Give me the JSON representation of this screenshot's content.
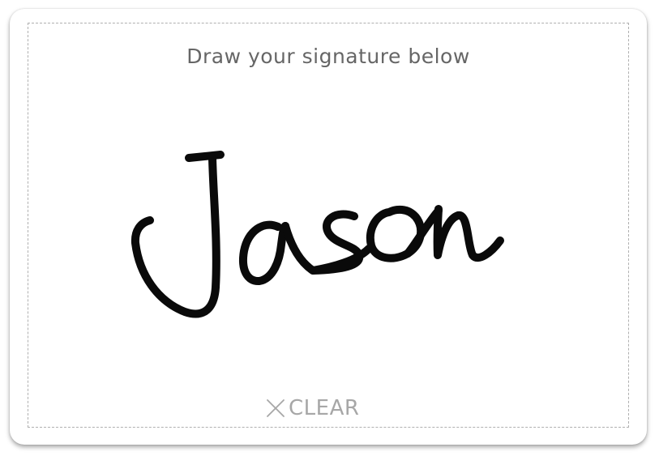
{
  "prompt": "Draw your signature below",
  "clear_button": {
    "label": "CLEAR",
    "icon": "close-icon"
  },
  "signature": {
    "text": "Jason"
  },
  "colors": {
    "ink": "#0a0a0a",
    "prompt_text": "#666666",
    "clear_text": "#a7a7a7",
    "border": "#b0b0b0"
  }
}
